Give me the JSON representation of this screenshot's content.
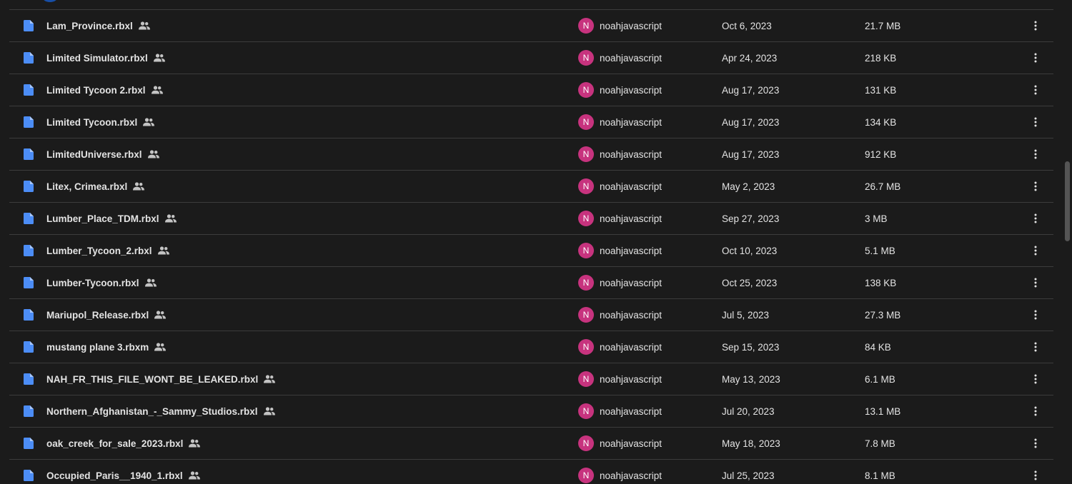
{
  "colors": {
    "background": "#1b1b1b",
    "divider": "#3c3c3c",
    "file_icon": "#4c8df6",
    "avatar": "#c7337e"
  },
  "icons": {
    "file": "document-icon",
    "shared": "people-icon",
    "more": "more-vert-icon"
  },
  "files": [
    {
      "name": "Lam_Province.rbxl",
      "owner_initial": "N",
      "owner": "noahjavascript",
      "date": "Oct 6, 2023",
      "size": "21.7 MB"
    },
    {
      "name": "Limited Simulator.rbxl",
      "owner_initial": "N",
      "owner": "noahjavascript",
      "date": "Apr 24, 2023",
      "size": "218 KB"
    },
    {
      "name": "Limited Tycoon 2.rbxl",
      "owner_initial": "N",
      "owner": "noahjavascript",
      "date": "Aug 17, 2023",
      "size": "131 KB"
    },
    {
      "name": "Limited Tycoon.rbxl",
      "owner_initial": "N",
      "owner": "noahjavascript",
      "date": "Aug 17, 2023",
      "size": "134 KB"
    },
    {
      "name": "LimitedUniverse.rbxl",
      "owner_initial": "N",
      "owner": "noahjavascript",
      "date": "Aug 17, 2023",
      "size": "912 KB"
    },
    {
      "name": "Litex, Crimea.rbxl",
      "owner_initial": "N",
      "owner": "noahjavascript",
      "date": "May 2, 2023",
      "size": "26.7 MB"
    },
    {
      "name": "Lumber_Place_TDM.rbxl",
      "owner_initial": "N",
      "owner": "noahjavascript",
      "date": "Sep 27, 2023",
      "size": "3 MB"
    },
    {
      "name": "Lumber_Tycoon_2.rbxl",
      "owner_initial": "N",
      "owner": "noahjavascript",
      "date": "Oct 10, 2023",
      "size": "5.1 MB"
    },
    {
      "name": "Lumber-Tycoon.rbxl",
      "owner_initial": "N",
      "owner": "noahjavascript",
      "date": "Oct 25, 2023",
      "size": "138 KB"
    },
    {
      "name": "Mariupol_Release.rbxl",
      "owner_initial": "N",
      "owner": "noahjavascript",
      "date": "Jul 5, 2023",
      "size": "27.3 MB"
    },
    {
      "name": "mustang plane 3.rbxm",
      "owner_initial": "N",
      "owner": "noahjavascript",
      "date": "Sep 15, 2023",
      "size": "84 KB"
    },
    {
      "name": "NAH_FR_THIS_FILE_WONT_BE_LEAKED.rbxl",
      "owner_initial": "N",
      "owner": "noahjavascript",
      "date": "May 13, 2023",
      "size": "6.1 MB"
    },
    {
      "name": "Northern_Afghanistan_-_Sammy_Studios.rbxl",
      "owner_initial": "N",
      "owner": "noahjavascript",
      "date": "Jul 20, 2023",
      "size": "13.1 MB"
    },
    {
      "name": "oak_creek_for_sale_2023.rbxl",
      "owner_initial": "N",
      "owner": "noahjavascript",
      "date": "May 18, 2023",
      "size": "7.8 MB"
    },
    {
      "name": "Occupied_Paris__1940_1.rbxl",
      "owner_initial": "N",
      "owner": "noahjavascript",
      "date": "Jul 25, 2023",
      "size": "8.1 MB"
    }
  ]
}
